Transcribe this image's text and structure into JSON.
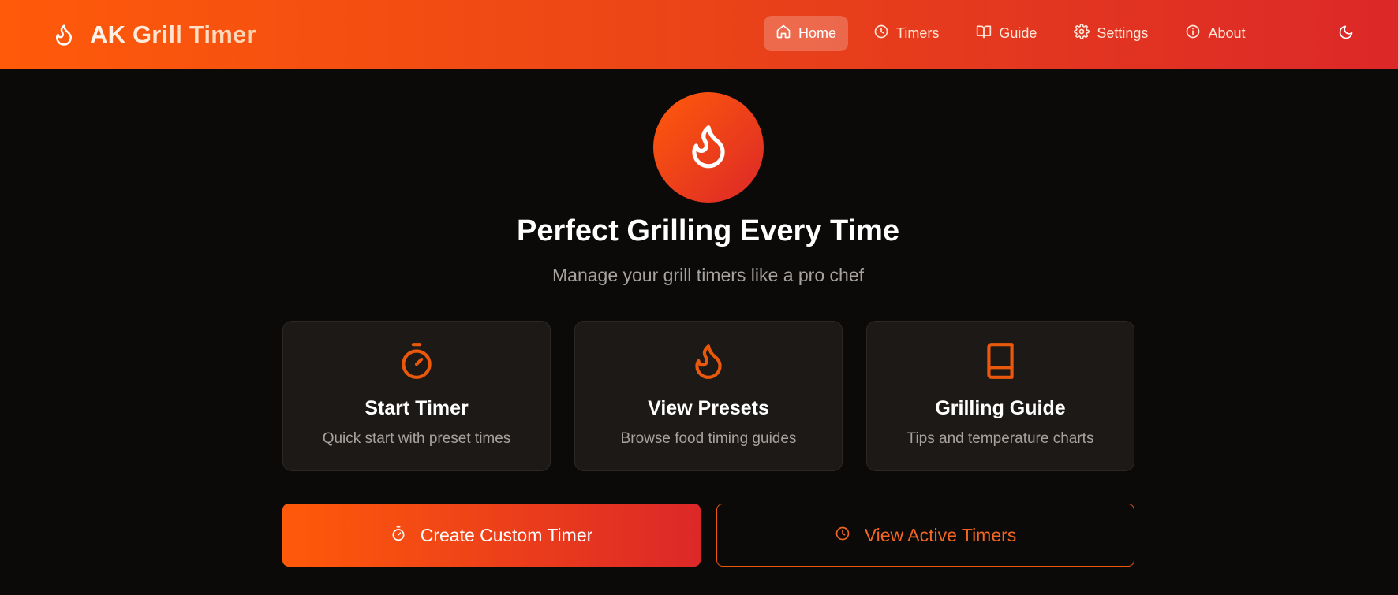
{
  "app": {
    "title": "AK Grill Timer",
    "brand_icon": "flame-icon"
  },
  "nav": {
    "items": [
      {
        "label": "Home",
        "icon": "home-icon",
        "active": true
      },
      {
        "label": "Timers",
        "icon": "clock-icon",
        "active": false
      },
      {
        "label": "Guide",
        "icon": "book-open-icon",
        "active": false
      },
      {
        "label": "Settings",
        "icon": "gear-icon",
        "active": false
      },
      {
        "label": "About",
        "icon": "info-icon",
        "active": false
      }
    ],
    "theme_toggle_icon": "moon-icon"
  },
  "hero": {
    "icon": "flame-icon",
    "title": "Perfect Grilling Every Time",
    "subtitle": "Manage your grill timers like a pro chef"
  },
  "cards": [
    {
      "icon": "stopwatch-icon",
      "title": "Start Timer",
      "description": "Quick start with preset times"
    },
    {
      "icon": "flame-icon",
      "title": "View Presets",
      "description": "Browse food timing guides"
    },
    {
      "icon": "book-icon",
      "title": "Grilling Guide",
      "description": "Tips and temperature charts"
    }
  ],
  "actions": {
    "primary": {
      "label": "Create Custom Timer",
      "icon": "stopwatch-icon"
    },
    "secondary": {
      "label": "View Active Timers",
      "icon": "clock-icon"
    }
  },
  "colors": {
    "accent": "#ea580c",
    "gradient_start": "#ff5a0a",
    "gradient_end": "#dc2828",
    "background": "#0b0a09",
    "card_background": "#1c1917",
    "muted_text": "#a8a29e"
  }
}
